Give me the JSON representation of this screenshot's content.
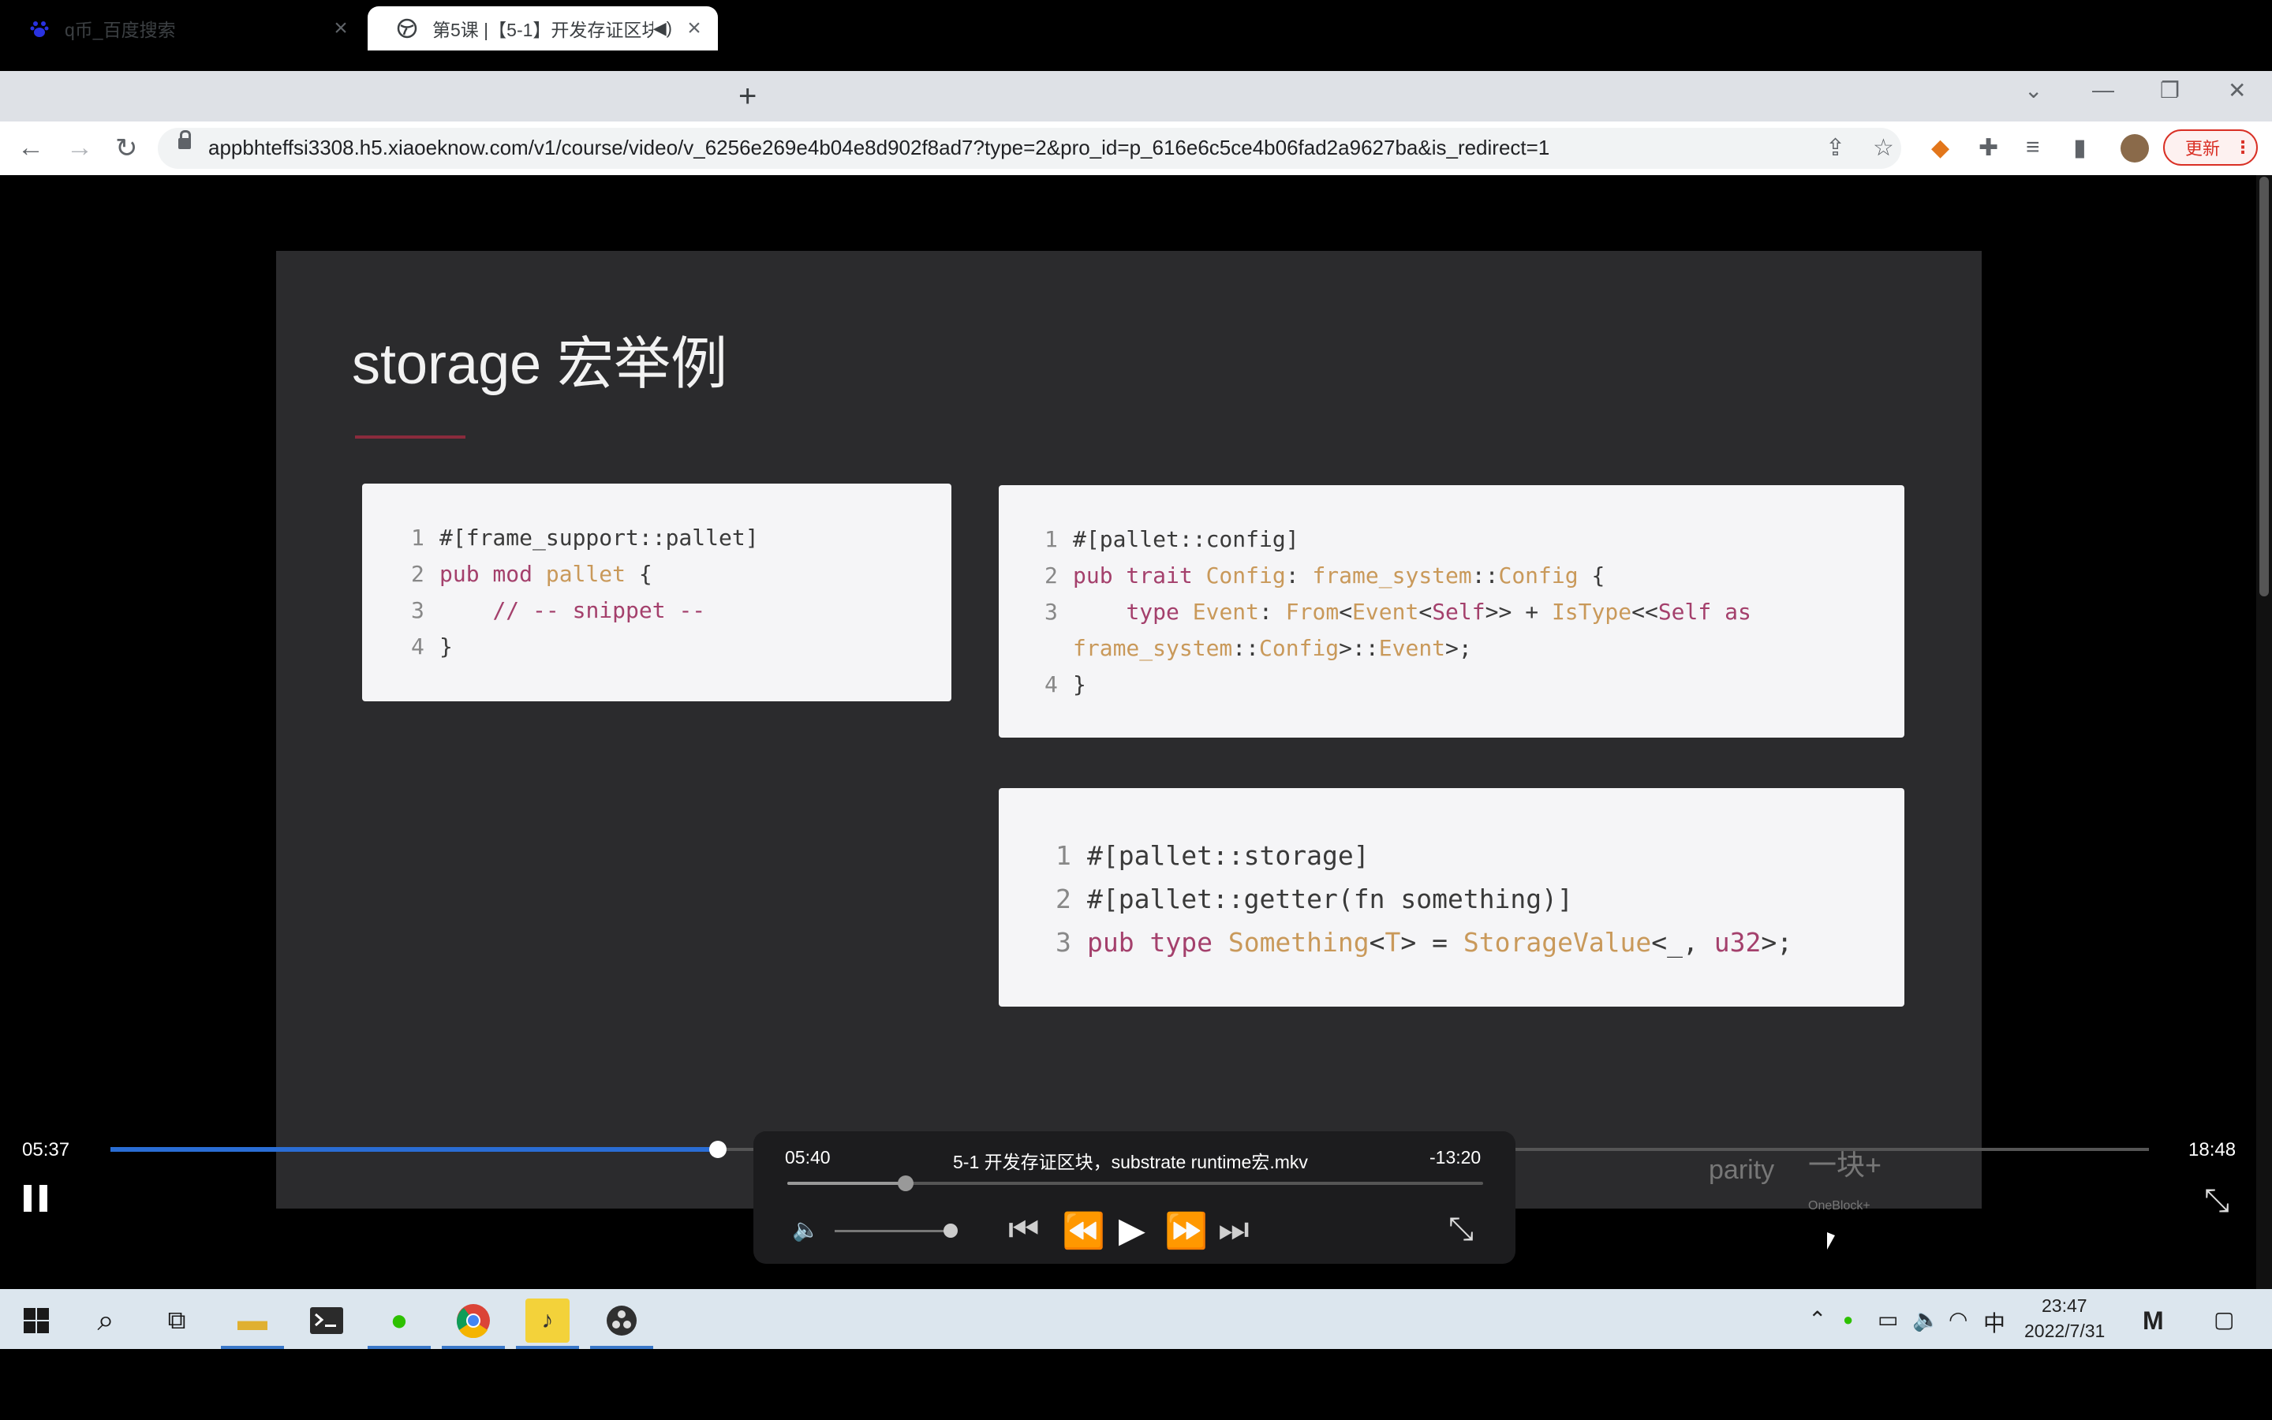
{
  "browser": {
    "tabs": [
      {
        "title": "q币_百度搜索",
        "icon": "baidu-paw-icon",
        "active": false
      },
      {
        "title": "第5课 |【5-1】开发存证区块",
        "icon": "globe-icon",
        "active": true
      }
    ],
    "url": "appbhteffsi3308.h5.xiaoeknow.com/v1/course/video/v_6256e269e4b04e8d902f8ad7?type=2&pro_id=p_616e6c5ce4b06fad2a9627ba&is_redirect=1",
    "update_button": "更新"
  },
  "slide": {
    "title": "storage 宏举例",
    "footer_brands": [
      "parity",
      "一块+",
      "OneBlock+"
    ]
  },
  "player": {
    "current_time": "05:37",
    "duration": "18:48",
    "progress": 0.298
  },
  "mini_player": {
    "time": "05:40",
    "title": "5-1 开发存证区块，substrate runtime宏.mkv",
    "remaining": "-13:20",
    "progress": 0.17,
    "volume": 0.9
  },
  "taskbar": {
    "apps": [
      "windows-start-icon",
      "search-icon",
      "task-view-icon",
      "file-explorer-icon",
      "terminal-icon",
      "wechat-icon",
      "chrome-icon",
      "media-player-icon",
      "obs-icon"
    ],
    "time": "23:47",
    "date": "2022/7/31",
    "ime": "中"
  }
}
